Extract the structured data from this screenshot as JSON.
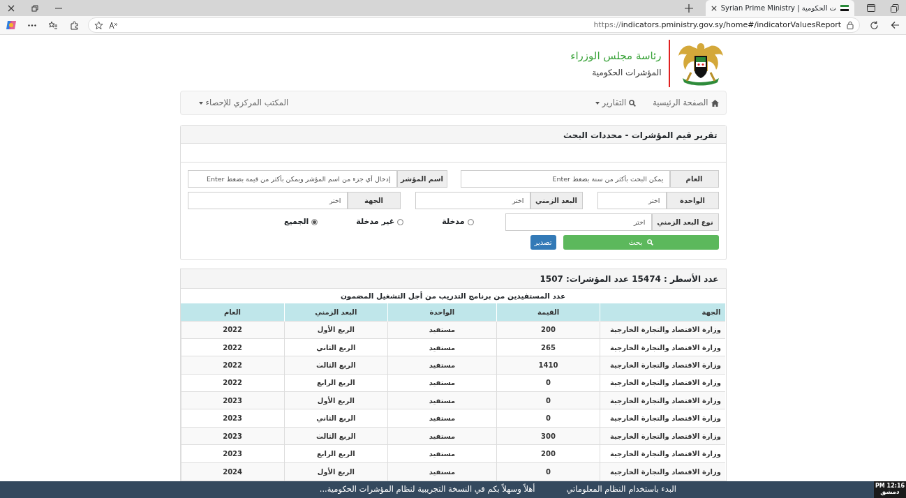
{
  "browser": {
    "tab_title": "Syrian Prime Ministry | ت الحكومية",
    "url_scheme": "https://",
    "url_rest": "indicators.pministry.gov.sy/home#/indicatorValuesReport"
  },
  "header": {
    "title": "رئاسة مجلس الوزراء",
    "subtitle": "المؤشرات الحكومية"
  },
  "nav": {
    "items": [
      {
        "label": "الصفحة الرئيسية",
        "dropdown": false
      },
      {
        "label": "التقارير",
        "dropdown": true
      }
    ],
    "items_end": [
      {
        "label": "المكتب المركزي للإحصاء",
        "dropdown": true
      }
    ]
  },
  "search": {
    "title": "تقرير قيم المؤشرات - محددات البحث",
    "fields": [
      {
        "label": "العام",
        "placeholder": "يمكن البحث بأكثر من سنة بضغط Enter"
      },
      {
        "label": "اسم المؤشر",
        "placeholder": "إدخال أي جزء من اسم المؤشر ويمكن بأكثر من قيمة بضغط Enter"
      },
      {
        "label": "الواحدة",
        "placeholder": "اختر"
      },
      {
        "label": "البعد الزمني",
        "placeholder": "اختر"
      },
      {
        "label": "الجهة",
        "placeholder": "اختر"
      },
      {
        "label": "نوع البعد الزمني",
        "placeholder": "اختر"
      }
    ],
    "radios": [
      {
        "label": "مدخلة",
        "selected": false
      },
      {
        "label": "غير مدخلة",
        "selected": false
      },
      {
        "label": "الجميع",
        "selected": true
      }
    ],
    "buttons": [
      {
        "label": "بحث",
        "kind": "search"
      },
      {
        "label": "تصدير",
        "kind": "export"
      }
    ]
  },
  "results": {
    "summary": "عدد الأسطر : 15474 عدد المؤشرات: 1507",
    "table_title": "عدد المستفيدين من برنامج التدريب من أجل التشغيل المضمون",
    "columns": [
      "الجهة",
      "القيمة",
      "الواحدة",
      "البعد الزمني",
      "العام"
    ],
    "rows": [
      [
        "وزارة الاقتصاد والتجارة الخارجية",
        "200",
        "مستفيد",
        "الربع الأول",
        "2022"
      ],
      [
        "وزارة الاقتصاد والتجارة الخارجية",
        "265",
        "مستفيد",
        "الربع الثاني",
        "2022"
      ],
      [
        "وزارة الاقتصاد والتجارة الخارجية",
        "1410",
        "مستفيد",
        "الربع الثالث",
        "2022"
      ],
      [
        "وزارة الاقتصاد والتجارة الخارجية",
        "0",
        "مستفيد",
        "الربع الرابع",
        "2022"
      ],
      [
        "وزارة الاقتصاد والتجارة الخارجية",
        "0",
        "مستفيد",
        "الربع الأول",
        "2023"
      ],
      [
        "وزارة الاقتصاد والتجارة الخارجية",
        "0",
        "مستفيد",
        "الربع الثاني",
        "2023"
      ],
      [
        "وزارة الاقتصاد والتجارة الخارجية",
        "300",
        "مستفيد",
        "الربع الثالث",
        "2023"
      ],
      [
        "وزارة الاقتصاد والتجارة الخارجية",
        "200",
        "مستفيد",
        "الربع الرابع",
        "2023"
      ],
      [
        "وزارة الاقتصاد والتجارة الخارجية",
        "0",
        "مستفيد",
        "الربع الأول",
        "2024"
      ]
    ]
  },
  "ticker": {
    "messages": [
      "البدء باستخدام النظام المعلوماتي",
      "أهلاً وسهلاً بكم في النسخة التجريبية لنظام المؤشرات الحكومية..."
    ],
    "time": "PM 12:16",
    "city": "دمشق"
  }
}
